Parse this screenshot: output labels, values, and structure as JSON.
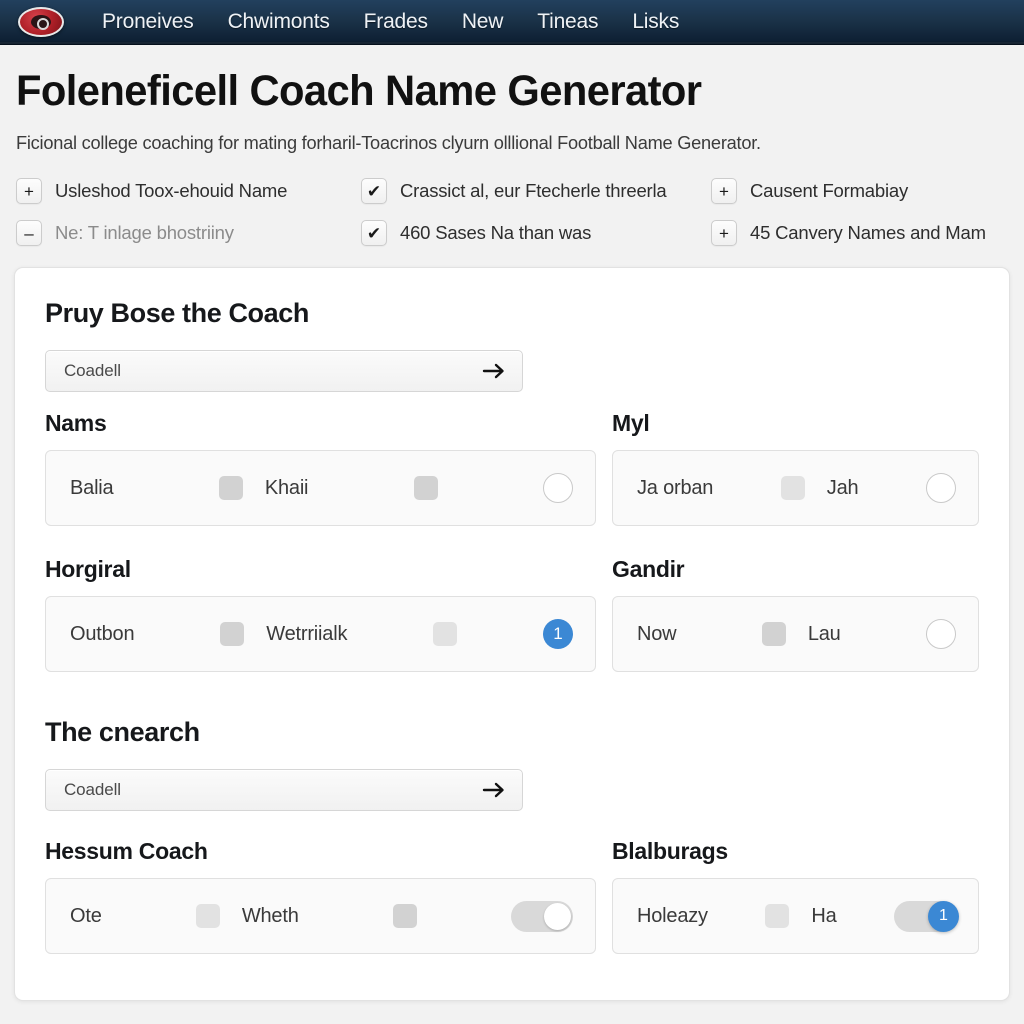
{
  "navbar": {
    "logo_icon": "football-shield-icon",
    "items": [
      {
        "label": "Proneives"
      },
      {
        "label": "Chwimonts"
      },
      {
        "label": "Frades"
      },
      {
        "label": "New"
      },
      {
        "label": "Tineas"
      },
      {
        "label": "Lisks"
      }
    ]
  },
  "hero": {
    "title": "Foleneficell Coach Name Generator",
    "subtitle": "Ficional college coaching for mating forharil-Toacrinos clyurn olllional Football Name Generator."
  },
  "features": [
    {
      "icon": "plus-icon",
      "glyph": "+",
      "label": "Usleshod Toox-ehouid Name",
      "muted": false
    },
    {
      "icon": "check-icon",
      "glyph": "✔",
      "label": "Crassict al, eur Ftecherle threerla",
      "muted": false
    },
    {
      "icon": "plus-icon",
      "glyph": "+",
      "label": "Causent Formabiay",
      "muted": false
    },
    {
      "icon": "minus-icon",
      "glyph": "–",
      "label": "Ne: T inlage bhostriiny",
      "muted": true
    },
    {
      "icon": "check-icon",
      "glyph": "✔",
      "label": "460 Sases Na than was",
      "muted": false
    },
    {
      "icon": "plus-icon",
      "glyph": "+",
      "label": "45 Canvery Names and Mam",
      "muted": false
    }
  ],
  "card": {
    "section_one": {
      "title": "Pruy Bose the Coach",
      "search": {
        "value": "Coadell",
        "submit_icon": "arrow-right-icon"
      },
      "rows": [
        {
          "left": {
            "label": "Nams",
            "text_a": "Balia",
            "text_b": "Khaii",
            "control": "radio",
            "control_value": ""
          },
          "right": {
            "label": "Myl",
            "text_a": "Ja orban",
            "text_b": "Jah",
            "control": "radio",
            "control_value": ""
          }
        },
        {
          "left": {
            "label": "Horgiral",
            "text_a": "Outbon",
            "text_b": "Wetrriialk",
            "control": "badge",
            "control_value": "1"
          },
          "right": {
            "label": "Gandir",
            "text_a": "Now",
            "text_b": "Lau",
            "control": "radio",
            "control_value": ""
          }
        }
      ]
    },
    "section_two": {
      "title": "The cnearch",
      "search": {
        "value": "Coadell",
        "submit_icon": "arrow-right-icon"
      },
      "rows": [
        {
          "left": {
            "label": "Hessum Coach",
            "text_a": "Ote",
            "text_b": "Wheth",
            "control": "toggle",
            "control_value": ""
          },
          "right": {
            "label": "Blalburags",
            "text_a": "Holeazy",
            "text_b": "Ha",
            "control": "toggle-blue",
            "control_value": "1"
          }
        }
      ]
    }
  },
  "colors": {
    "navbar_top": "#22405e",
    "navbar_bottom": "#0a1724",
    "accent_blue": "#3b88d4",
    "logo_red": "#b02028",
    "page_bg": "#f2f2f2"
  }
}
